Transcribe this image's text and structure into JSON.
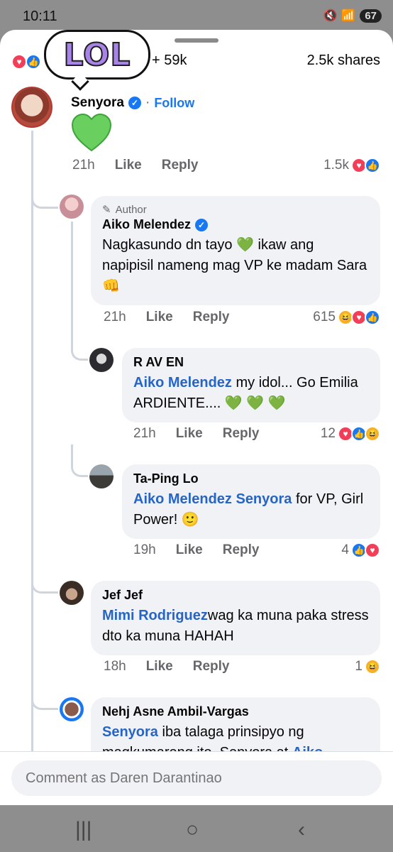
{
  "status": {
    "time": "10:11",
    "battery": "67"
  },
  "reactions": {
    "count": "+ 59k",
    "shares": "2.5k shares"
  },
  "sticker": {
    "text": "LOL"
  },
  "comments": [
    {
      "name": "Senyora",
      "follow": "Follow",
      "time": "21h",
      "like": "Like",
      "reply": "Reply",
      "reaction_count": "1.5k"
    },
    {
      "tag": "Author",
      "name": "Aiko Melendez",
      "text_a": "Nagkasundo dn tayo ",
      "text_b": " ikaw ang napipisil nameng mag VP ke madam Sara ",
      "emoji_end": "👊",
      "time": "21h",
      "like": "Like",
      "reply": "Reply",
      "reaction_count": "615"
    },
    {
      "name": "R AV EN",
      "mention": "Aiko Melendez",
      "text": " my idol... Go Emilia ARDIENTE....",
      "hearts": "💚 💚 💚",
      "time": "21h",
      "like": "Like",
      "reply": "Reply",
      "reaction_count": "12"
    },
    {
      "name": "Ta-Ping Lo",
      "mention": "Aiko Melendez Senyora",
      "text": " for VP, Girl Power! ",
      "emoji_end": "🙂",
      "time": "19h",
      "like": "Like",
      "reply": "Reply",
      "reaction_count": "4"
    },
    {
      "name": "Jef Jef",
      "mention": "Mimi Rodriguez",
      "text": "wag ka muna paka stress dto ka muna HAHAH",
      "time": "18h",
      "like": "Like",
      "reply": "Reply",
      "reaction_count": "1"
    },
    {
      "name": "Nehj Asne Ambil-Vargas",
      "mention": "Senyora",
      "text": " iba talaga prinsipyo ng magkumareng ito. Senyora at ",
      "mention2": "Aiko"
    }
  ],
  "composer": {
    "placeholder": "Comment as Daren Darantinao"
  }
}
